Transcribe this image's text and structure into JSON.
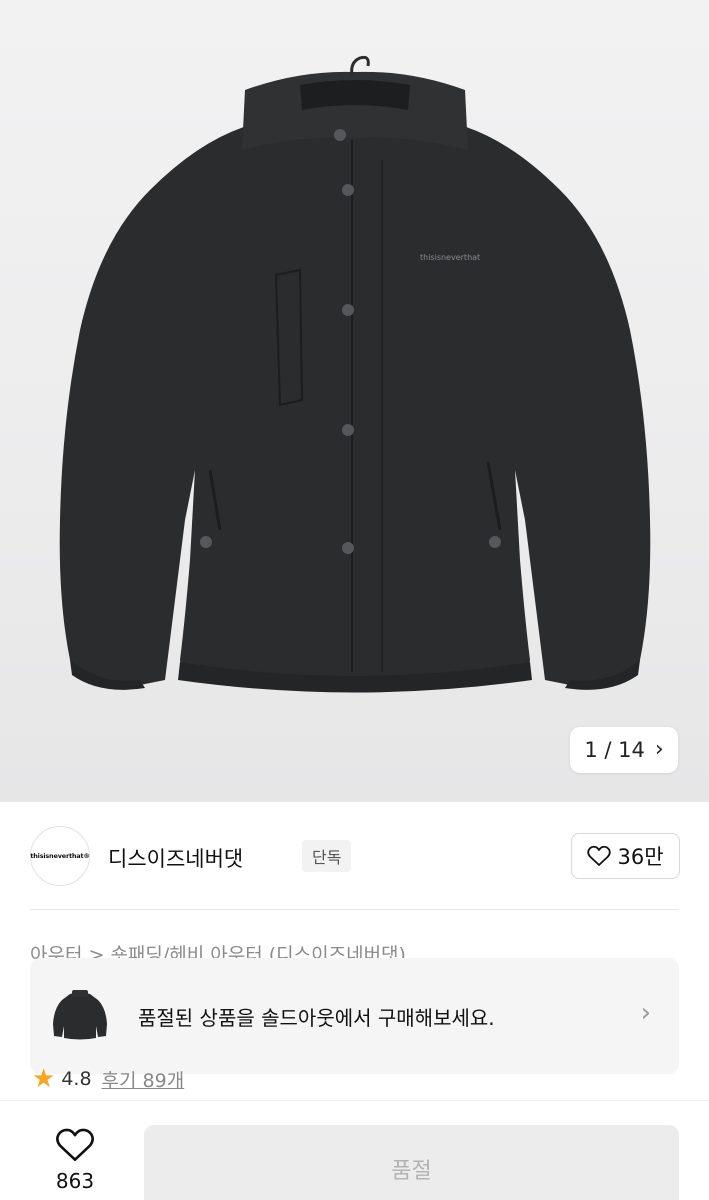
{
  "gallery": {
    "current": "1",
    "separator": "/",
    "total": "14",
    "counter_text": "1 / 14"
  },
  "brand": {
    "logo_text": "thisisneverthat®",
    "name": "디스이즈네버댓",
    "tag": "단독",
    "likes": "36만",
    "jacket_logo": "thisisneverthat"
  },
  "breadcrumb": "아우터  >  숏패딩/헤비 아우터 (디스이즈네버댓)",
  "banner": {
    "message": "품절된 상품을 솔드아웃에서 구매해보세요."
  },
  "rating": {
    "score": "4.8",
    "reviews": "후기 89개"
  },
  "bottom": {
    "wish_count": "863",
    "buy_label": "품절"
  },
  "colors": {
    "jacket": "#2b2c2e",
    "star": "#f5a623",
    "button_disabled_bg": "#ececec",
    "button_disabled_text": "#b3b3b3"
  },
  "icons": [
    "chevron-right-icon",
    "heart-icon",
    "star-icon"
  ]
}
